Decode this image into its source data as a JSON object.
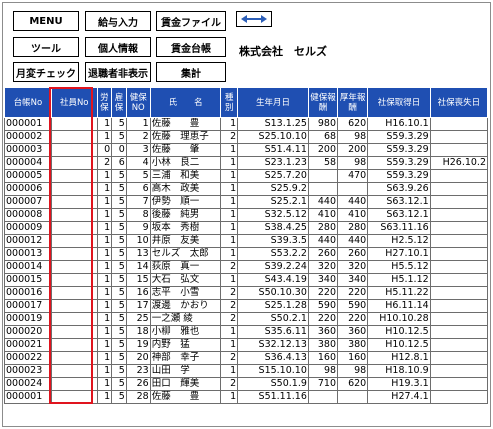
{
  "toolbar": {
    "menu": "MENU",
    "salary_input": "給与入力",
    "wage_file": "賃金ファイル",
    "tools": "ツール",
    "personal_info": "個人情報",
    "wage_ledger": "賃金台帳",
    "monthly_check": "月変チェック",
    "hide_retired": "退職者非表示",
    "total": "集計",
    "swap_icon": "double-arrow-icon"
  },
  "company_name": "株式会社　セルズ",
  "highlight_color": "#e0141e",
  "header_color": "#1f4fb2",
  "table": {
    "headers": {
      "ledger_no": "台帳No",
      "employee_no": "社員No",
      "labor_insurance": "労保",
      "employment_insurance": "雇保",
      "health_insurance_no": "健保NO",
      "name": "氏　　名",
      "type": "種別",
      "birth_date": "生年月日",
      "health_remuneration": "健保報酬",
      "pension_remuneration": "厚年報酬",
      "acquired_date": "社保取得日",
      "lost_date": "社保喪失日"
    },
    "rows": [
      {
        "ledger": "000001",
        "emp": "",
        "labor": "1",
        "employ": "5",
        "hno": "1",
        "name": "佐藤　　豊",
        "type": "1",
        "birth": "S13.1.25",
        "health": "980",
        "pension": "620",
        "acq": "H16.10.1",
        "lost": ""
      },
      {
        "ledger": "000002",
        "emp": "",
        "labor": "1",
        "employ": "5",
        "hno": "2",
        "name": "佐藤　理恵子",
        "type": "2",
        "birth": "S25.10.10",
        "health": "68",
        "pension": "98",
        "acq": "S59.3.29",
        "lost": ""
      },
      {
        "ledger": "000003",
        "emp": "",
        "labor": "0",
        "employ": "0",
        "hno": "3",
        "name": "佐藤　　肇",
        "type": "1",
        "birth": "S51.4.11",
        "health": "200",
        "pension": "200",
        "acq": "S59.3.29",
        "lost": ""
      },
      {
        "ledger": "000004",
        "emp": "",
        "labor": "2",
        "employ": "6",
        "hno": "4",
        "name": "小林　良二",
        "type": "1",
        "birth": "S23.1.23",
        "health": "58",
        "pension": "98",
        "acq": "S59.3.29",
        "lost": "H26.10.2"
      },
      {
        "ledger": "000005",
        "emp": "",
        "labor": "1",
        "employ": "5",
        "hno": "5",
        "name": "三浦　和美",
        "type": "1",
        "birth": "S25.7.20",
        "health": "",
        "pension": "470",
        "acq": "S59.3.29",
        "lost": ""
      },
      {
        "ledger": "000006",
        "emp": "",
        "labor": "1",
        "employ": "5",
        "hno": "6",
        "name": "高木　政美",
        "type": "1",
        "birth": "S25.9.2",
        "health": "",
        "pension": "",
        "acq": "S63.9.26",
        "lost": ""
      },
      {
        "ledger": "000007",
        "emp": "",
        "labor": "1",
        "employ": "5",
        "hno": "7",
        "name": "伊勢　順一",
        "type": "1",
        "birth": "S25.2.1",
        "health": "440",
        "pension": "440",
        "acq": "S63.12.1",
        "lost": ""
      },
      {
        "ledger": "000008",
        "emp": "",
        "labor": "1",
        "employ": "5",
        "hno": "8",
        "name": "後藤　純男",
        "type": "1",
        "birth": "S32.5.12",
        "health": "410",
        "pension": "410",
        "acq": "S63.12.1",
        "lost": ""
      },
      {
        "ledger": "000009",
        "emp": "",
        "labor": "1",
        "employ": "5",
        "hno": "9",
        "name": "坂本　秀樹",
        "type": "1",
        "birth": "S38.4.25",
        "health": "280",
        "pension": "280",
        "acq": "S63.11.16",
        "lost": ""
      },
      {
        "ledger": "000012",
        "emp": "",
        "labor": "1",
        "employ": "5",
        "hno": "10",
        "name": "井原　友美",
        "type": "1",
        "birth": "S39.3.5",
        "health": "440",
        "pension": "440",
        "acq": "H2.5.12",
        "lost": ""
      },
      {
        "ledger": "000013",
        "emp": "",
        "labor": "1",
        "employ": "5",
        "hno": "13",
        "name": "セルズ　太郎",
        "type": "1",
        "birth": "S53.2.2",
        "health": "260",
        "pension": "260",
        "acq": "H27.10.1",
        "lost": ""
      },
      {
        "ledger": "000014",
        "emp": "",
        "labor": "1",
        "employ": "5",
        "hno": "14",
        "name": "荻原　真一",
        "type": "2",
        "birth": "S39.2.24",
        "health": "320",
        "pension": "320",
        "acq": "H5.5.12",
        "lost": ""
      },
      {
        "ledger": "000015",
        "emp": "",
        "labor": "1",
        "employ": "5",
        "hno": "15",
        "name": "大石　弘文",
        "type": "1",
        "birth": "S43.4.19",
        "health": "340",
        "pension": "340",
        "acq": "H5.1.12",
        "lost": ""
      },
      {
        "ledger": "000016",
        "emp": "",
        "labor": "1",
        "employ": "5",
        "hno": "16",
        "name": "志平　小雪",
        "type": "2",
        "birth": "S50.10.30",
        "health": "220",
        "pension": "220",
        "acq": "H5.11.22",
        "lost": ""
      },
      {
        "ledger": "000017",
        "emp": "",
        "labor": "1",
        "employ": "5",
        "hno": "17",
        "name": "渡邊　かおり",
        "type": "2",
        "birth": "S25.1.28",
        "health": "590",
        "pension": "590",
        "acq": "H6.11.14",
        "lost": ""
      },
      {
        "ledger": "000019",
        "emp": "",
        "labor": "1",
        "employ": "5",
        "hno": "25",
        "name": "一之瀬 綾",
        "type": "2",
        "birth": "S50.2.1",
        "health": "220",
        "pension": "220",
        "acq": "H10.10.28",
        "lost": ""
      },
      {
        "ledger": "000020",
        "emp": "",
        "labor": "1",
        "employ": "5",
        "hno": "18",
        "name": "小柳　雅也",
        "type": "1",
        "birth": "S35.6.11",
        "health": "360",
        "pension": "360",
        "acq": "H10.12.5",
        "lost": ""
      },
      {
        "ledger": "000021",
        "emp": "",
        "labor": "1",
        "employ": "5",
        "hno": "19",
        "name": "内野　猛",
        "type": "1",
        "birth": "S32.12.13",
        "health": "380",
        "pension": "380",
        "acq": "H10.12.5",
        "lost": ""
      },
      {
        "ledger": "000022",
        "emp": "",
        "labor": "1",
        "employ": "5",
        "hno": "20",
        "name": "神部　幸子",
        "type": "2",
        "birth": "S36.4.13",
        "health": "160",
        "pension": "160",
        "acq": "H12.8.1",
        "lost": ""
      },
      {
        "ledger": "000023",
        "emp": "",
        "labor": "1",
        "employ": "5",
        "hno": "23",
        "name": "山田　学",
        "type": "1",
        "birth": "S15.10.10",
        "health": "98",
        "pension": "98",
        "acq": "H18.10.9",
        "lost": ""
      },
      {
        "ledger": "000024",
        "emp": "",
        "labor": "1",
        "employ": "5",
        "hno": "26",
        "name": "田口　輝美",
        "type": "2",
        "birth": "S50.1.9",
        "health": "710",
        "pension": "620",
        "acq": "H19.3.1",
        "lost": ""
      },
      {
        "ledger": "000001",
        "emp": "",
        "labor": "1",
        "employ": "5",
        "hno": "28",
        "name": "佐藤　　豊",
        "type": "1",
        "birth": "S51.11.16",
        "health": "",
        "pension": "",
        "acq": "H27.4.1",
        "lost": ""
      }
    ]
  }
}
